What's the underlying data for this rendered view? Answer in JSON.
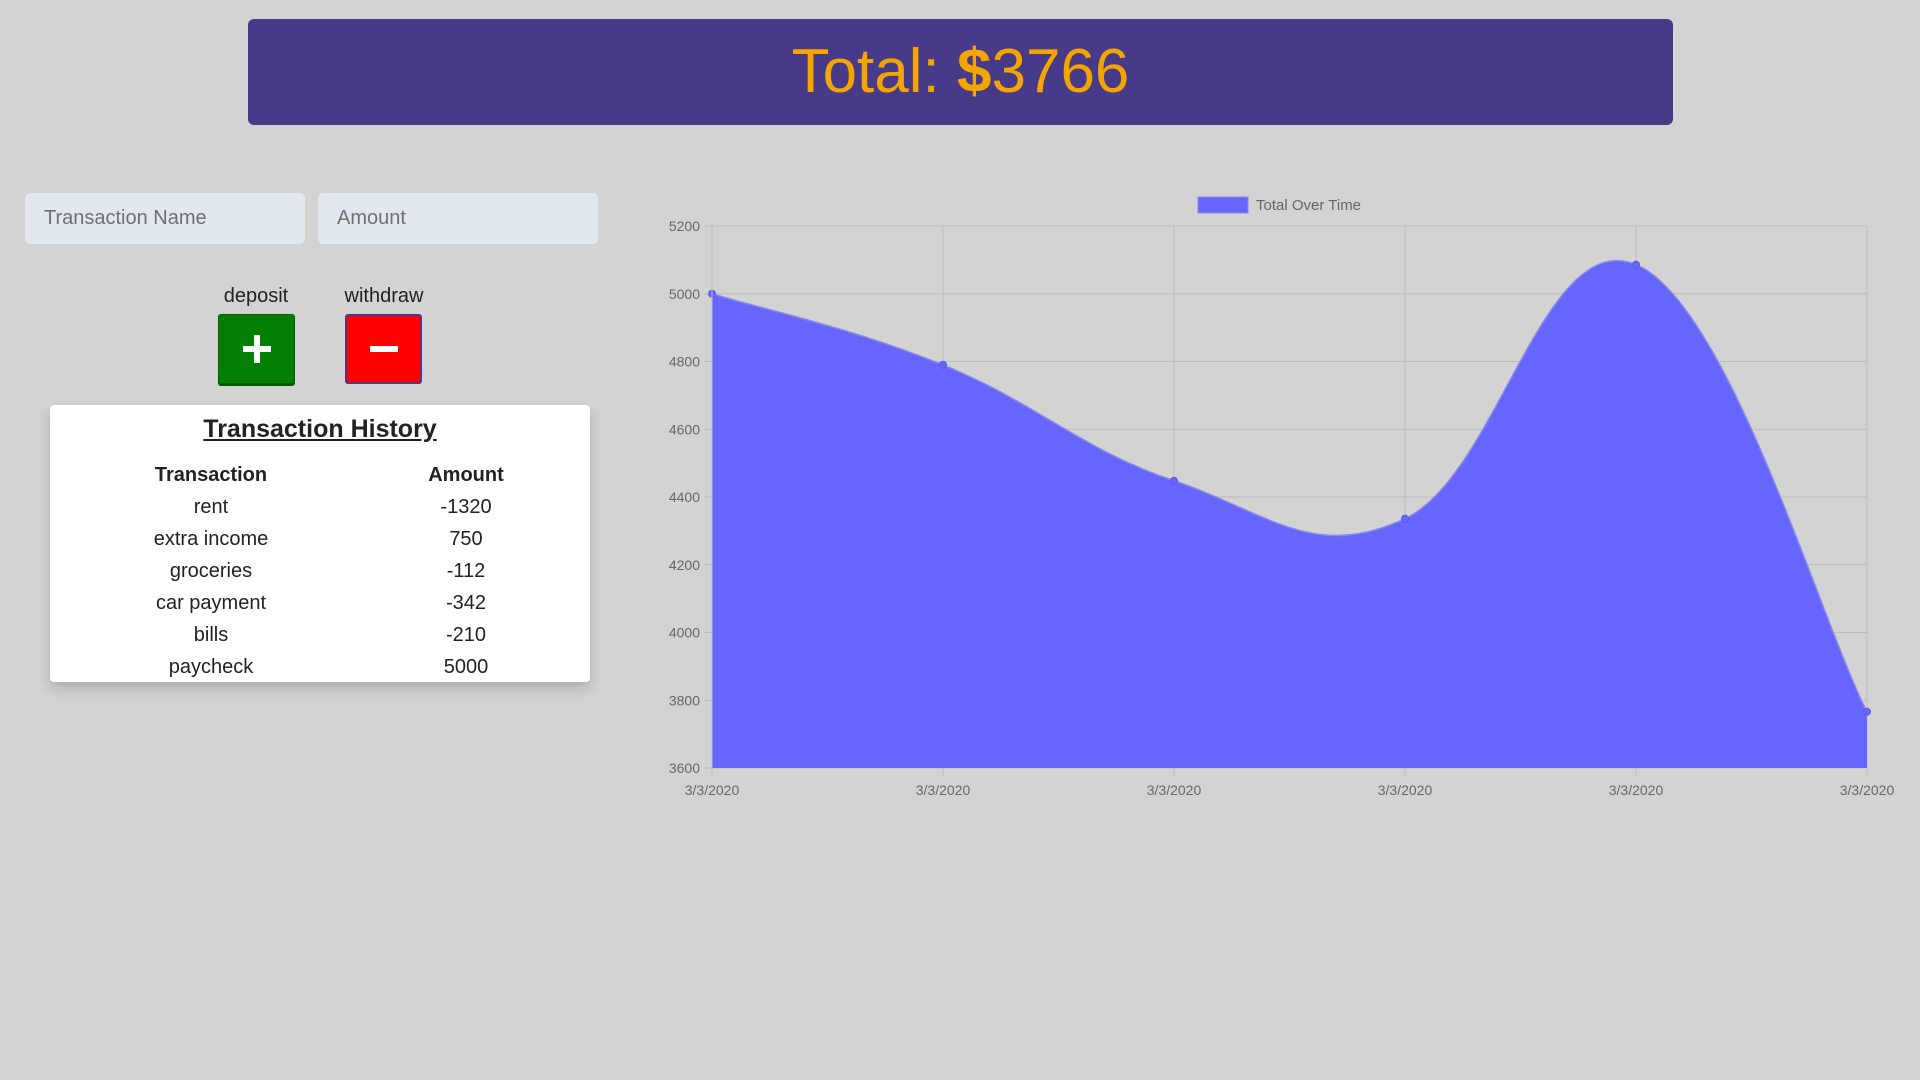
{
  "header": {
    "total_prefix": "Total: ",
    "currency_symbol": "$",
    "total_value": "3766"
  },
  "form": {
    "name_placeholder": "Transaction Name",
    "amount_placeholder": "Amount",
    "deposit_label": "deposit",
    "withdraw_label": "withdraw",
    "deposit_icon": "plus-icon",
    "withdraw_icon": "minus-icon"
  },
  "history": {
    "title": "Transaction History",
    "columns": [
      "Transaction",
      "Amount"
    ],
    "rows": [
      {
        "name": "rent",
        "amount": "-1320"
      },
      {
        "name": "extra income",
        "amount": "750"
      },
      {
        "name": "groceries",
        "amount": "-112"
      },
      {
        "name": "car payment",
        "amount": "-342"
      },
      {
        "name": "bills",
        "amount": "-210"
      },
      {
        "name": "paycheck",
        "amount": "5000"
      }
    ]
  },
  "colors": {
    "banner": "#473b89",
    "total_text": "#f5a500",
    "deposit": "#038003",
    "withdraw": "#ff0000",
    "series_fill": "#6666ff"
  },
  "chart_data": {
    "type": "area",
    "x": [
      "3/3/2020",
      "3/3/2020",
      "3/3/2020",
      "3/3/2020",
      "3/3/2020",
      "3/3/2020"
    ],
    "series": [
      {
        "name": "Total Over Time",
        "values": [
          5000,
          4790,
          4448,
          4336,
          5086,
          3766
        ]
      }
    ],
    "ylim": [
      3600,
      5200
    ],
    "yticks": [
      3600,
      3800,
      4000,
      4200,
      4400,
      4600,
      4800,
      5000,
      5200
    ],
    "grid": true,
    "legend": "top-center"
  }
}
